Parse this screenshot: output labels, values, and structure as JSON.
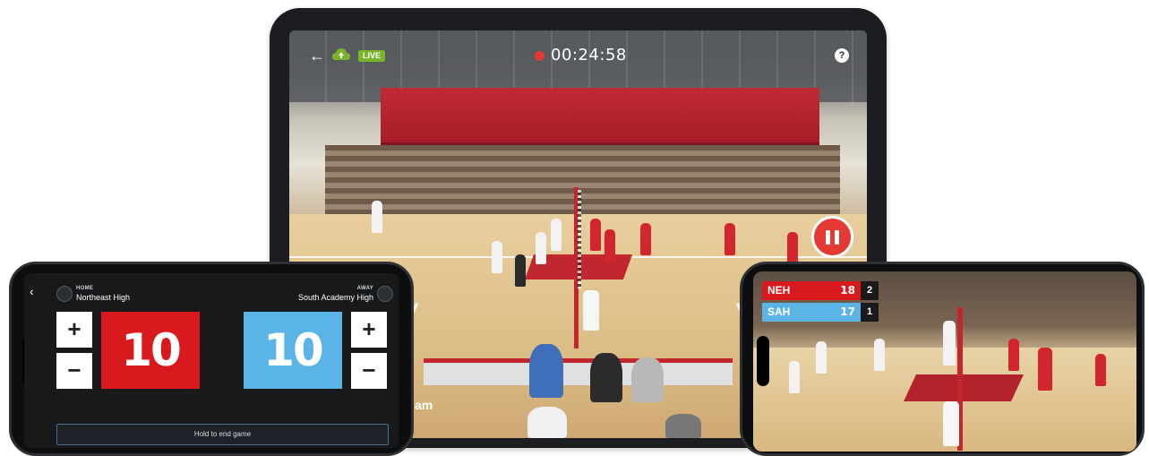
{
  "tablet": {
    "live_badge": "LIVE",
    "timer": "00:24:58",
    "help": "?",
    "partial_text": "am"
  },
  "scoreboard": {
    "home": {
      "tag": "HOME",
      "name": "Northeast High",
      "score": "10",
      "color": "#d8191e"
    },
    "away": {
      "tag": "AWAY",
      "name": "South Academy High",
      "score": "10",
      "color": "#5ab5e6"
    },
    "plus": "+",
    "minus": "−",
    "end_game_label": "Hold to end game"
  },
  "stream_scorebug": {
    "team1": {
      "name": "NEH",
      "score": "18",
      "sets": "2",
      "color": "#d8191e"
    },
    "team2": {
      "name": "SAH",
      "score": "17",
      "sets": "1",
      "color": "#5ab5e6"
    }
  },
  "icons": {
    "back": "back-arrow-icon",
    "cloud": "cloud-upload-icon",
    "rec": "record-dot-icon",
    "pause": "pause-icon",
    "help": "help-icon",
    "team_logo": "team-logo-icon"
  },
  "colors": {
    "live_green": "#79b42b",
    "record_red": "#e53935"
  }
}
